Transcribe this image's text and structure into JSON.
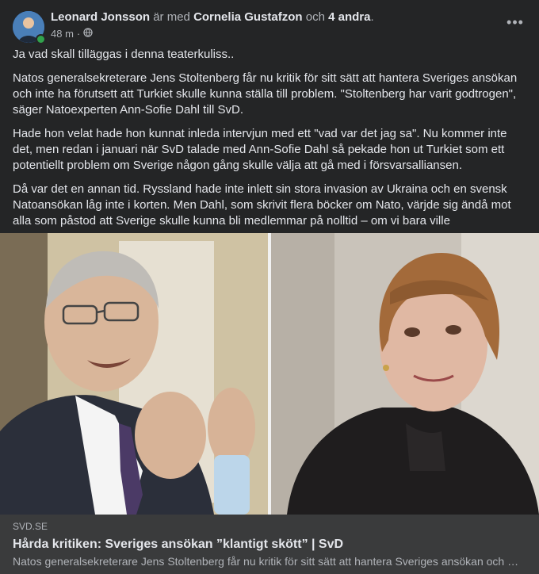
{
  "post": {
    "author": "Leonard Jonsson",
    "with_text": "är med",
    "tagged": "Cornelia Gustafzon",
    "and_text": "och",
    "others": "4 andra",
    "period": ".",
    "time": "48 m",
    "separator": "·",
    "privacy_icon": "globe-icon",
    "more_icon": "more-horizontal-icon",
    "more_label": "•••",
    "paragraphs": [
      "Ja vad skall tilläggas i denna teaterkuliss..",
      "Natos generalsekreterare Jens Stoltenberg får nu kritik för sitt sätt att hantera Sveriges ansökan och inte ha förutsett att Turkiet skulle kunna ställa till problem. \"Stoltenberg har varit godtrogen\", säger Natoexperten Ann-Sofie Dahl till SvD.",
      "Hade hon velat hade hon kunnat inleda intervjun med ett \"vad var det jag sa\". Nu kommer inte det, men redan i januari när SvD talade med Ann-Sofie Dahl så pekade hon ut Turkiet som ett potentiellt problem om Sverige någon gång skulle välja att gå med i försvarsalliansen.",
      "Då var det en annan tid. Ryssland hade inte inlett sin stora invasion av Ukraina och en svensk Natoansökan låg inte i korten. Men Dahl, som skrivit flera böcker om Nato, värjde sig ändå mot alla som påstod att Sverige skulle kunna bli medlemmar på nolltid – om vi bara ville"
    ]
  },
  "link": {
    "domain": "SVD.SE",
    "title": "Hårda kritiken: Sveriges ansökan ”klantigt skött” | SvD",
    "description": "Natos generalsekreterare Jens Stoltenberg får nu kritik för sitt sätt att hantera Sveriges ansökan och inte ha förutsett att Turkiet skulle kunna ställa till problem."
  },
  "colors": {
    "background": "#242526",
    "card": "#3a3b3c",
    "text": "#e4e6eb",
    "muted": "#b0b3b8",
    "online": "#31a24c"
  }
}
